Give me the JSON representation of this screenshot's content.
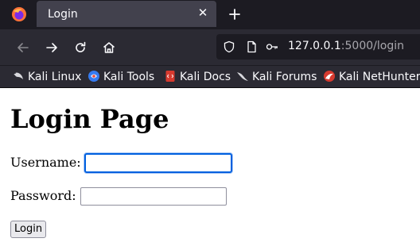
{
  "browser": {
    "tab": {
      "title": "Login",
      "close_glyph": "✕"
    },
    "newtab_icon": "plus-icon",
    "urlbar": {
      "host": "127.0.0.1",
      "path": ":5000/login"
    },
    "bookmarks": [
      {
        "label": "Kali Linux",
        "icon": "kali-dragon-icon"
      },
      {
        "label": "Kali Tools",
        "icon": "kali-tools-icon"
      },
      {
        "label": "Kali Docs",
        "icon": "kali-docs-icon"
      },
      {
        "label": "Kali Forums",
        "icon": "kali-forums-icon"
      },
      {
        "label": "Kali NetHunter",
        "icon": "kali-nethunter-icon"
      }
    ],
    "colors": {
      "chrome_dark": "#1c1b22",
      "toolbar": "#2b2a33",
      "tab_active": "#42414d",
      "focus_ring": "#0060df"
    }
  },
  "page": {
    "heading": "Login Page",
    "username_label": "Username:",
    "username_value": "",
    "password_label": "Password:",
    "password_value": "",
    "login_button": "Login"
  }
}
